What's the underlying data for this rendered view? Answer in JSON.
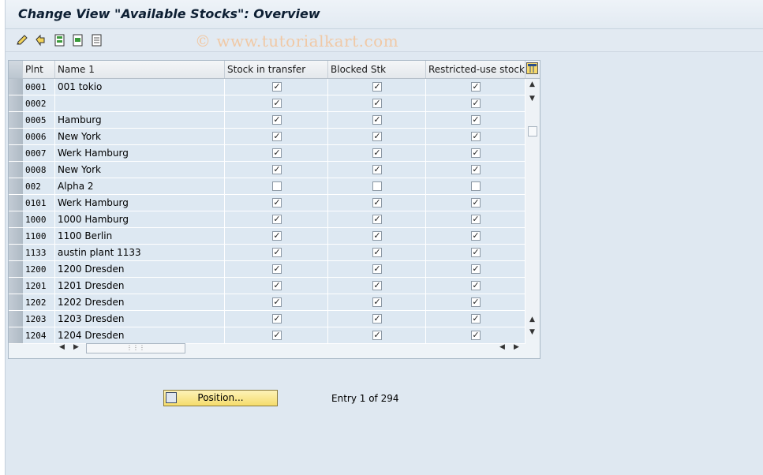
{
  "window": {
    "title": "Change View \"Available Stocks\": Overview"
  },
  "toolbar": {
    "buttons": [
      {
        "icon": "edit-icon"
      },
      {
        "icon": "undo-icon"
      },
      {
        "icon": "select-all-icon"
      },
      {
        "icon": "select-block-icon"
      },
      {
        "icon": "deselect-all-icon"
      }
    ],
    "watermark": "© www.tutorialkart.com"
  },
  "table": {
    "columns": [
      "Plnt",
      "Name 1",
      "Stock in transfer",
      "Blocked Stk",
      "Restricted-use stock"
    ],
    "rows": [
      {
        "plnt": "0001",
        "name": "001 tokio",
        "transfer": true,
        "blocked": true,
        "restricted": true
      },
      {
        "plnt": "0002",
        "name": "",
        "transfer": true,
        "blocked": true,
        "restricted": true
      },
      {
        "plnt": "0005",
        "name": "Hamburg",
        "transfer": true,
        "blocked": true,
        "restricted": true
      },
      {
        "plnt": "0006",
        "name": "New York",
        "transfer": true,
        "blocked": true,
        "restricted": true
      },
      {
        "plnt": "0007",
        "name": "Werk Hamburg",
        "transfer": true,
        "blocked": true,
        "restricted": true
      },
      {
        "plnt": "0008",
        "name": "New York",
        "transfer": true,
        "blocked": true,
        "restricted": true
      },
      {
        "plnt": "002",
        "name": "Alpha 2",
        "transfer": false,
        "blocked": false,
        "restricted": false
      },
      {
        "plnt": "0101",
        "name": "Werk Hamburg",
        "transfer": true,
        "blocked": true,
        "restricted": true
      },
      {
        "plnt": "1000",
        "name": "1000 Hamburg",
        "transfer": true,
        "blocked": true,
        "restricted": true
      },
      {
        "plnt": "1100",
        "name": "1100 Berlin",
        "transfer": true,
        "blocked": true,
        "restricted": true
      },
      {
        "plnt": "1133",
        "name": "austin plant 1133",
        "transfer": true,
        "blocked": true,
        "restricted": true
      },
      {
        "plnt": "1200",
        "name": "1200 Dresden",
        "transfer": true,
        "blocked": true,
        "restricted": true
      },
      {
        "plnt": "1201",
        "name": "1201 Dresden",
        "transfer": true,
        "blocked": true,
        "restricted": true
      },
      {
        "plnt": "1202",
        "name": "1202 Dresden",
        "transfer": true,
        "blocked": true,
        "restricted": true
      },
      {
        "plnt": "1203",
        "name": "1203 Dresden",
        "transfer": true,
        "blocked": true,
        "restricted": true
      },
      {
        "plnt": "1204",
        "name": "1204 Dresden",
        "transfer": true,
        "blocked": true,
        "restricted": true
      }
    ]
  },
  "footer": {
    "position_label": "Position...",
    "entry_text": "Entry 1 of 294"
  },
  "colors": {
    "background": "#dfe8f1",
    "cell": "#dde8f2",
    "button": "#f5dc6c"
  }
}
